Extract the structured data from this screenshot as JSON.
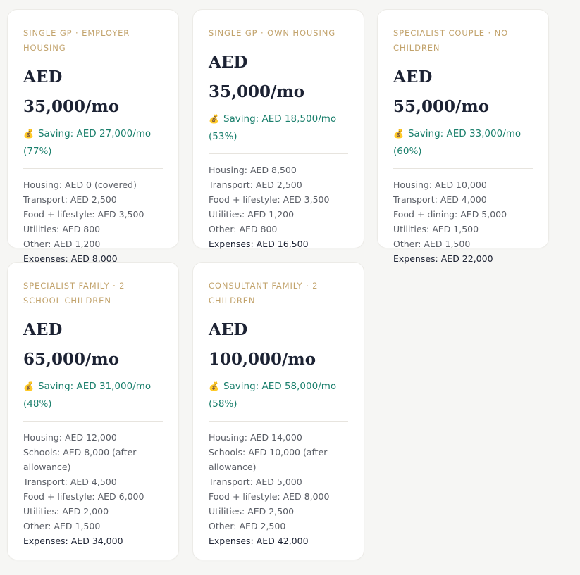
{
  "cards": [
    {
      "label": "SINGLE GP · EMPLOYER HOUSING",
      "salary": "AED 35,000/mo",
      "saving_icon": "money-bag-icon",
      "saving": "Saving: AED 27,000/mo (77%)",
      "expenses": [
        "Housing: AED 0 (covered)",
        "Transport: AED 2,500",
        "Food + lifestyle: AED 3,500",
        "Utilities: AED 800",
        "Other: AED 1,200"
      ],
      "total": "Expenses: AED 8,000"
    },
    {
      "label": "SINGLE GP · OWN HOUSING",
      "salary": "AED 35,000/mo",
      "saving_icon": "money-bag-icon",
      "saving": "Saving: AED 18,500/mo (53%)",
      "expenses": [
        "Housing: AED 8,500",
        "Transport: AED 2,500",
        "Food + lifestyle: AED 3,500",
        "Utilities: AED 1,200",
        "Other: AED 800"
      ],
      "total": "Expenses: AED 16,500"
    },
    {
      "label": "SPECIALIST COUPLE · NO CHILDREN",
      "salary": "AED 55,000/mo",
      "saving_icon": "money-bag-icon",
      "saving": "Saving: AED 33,000/mo (60%)",
      "expenses": [
        "Housing: AED 10,000",
        "Transport: AED 4,000",
        "Food + dining: AED 5,000",
        "Utilities: AED 1,500",
        "Other: AED 1,500"
      ],
      "total": "Expenses: AED 22,000"
    },
    {
      "label": "SPECIALIST FAMILY · 2 SCHOOL CHILDREN",
      "salary": "AED 65,000/mo",
      "saving_icon": "money-bag-icon",
      "saving": "Saving: AED 31,000/mo (48%)",
      "expenses": [
        "Housing: AED 12,000",
        "Schools: AED 8,000 (after allowance)",
        "Transport: AED 4,500",
        "Food + lifestyle: AED 6,000",
        "Utilities: AED 2,000",
        "Other: AED 1,500"
      ],
      "total": "Expenses: AED 34,000"
    },
    {
      "label": "CONSULTANT FAMILY · 2 CHILDREN",
      "salary": "AED 100,000/mo",
      "saving_icon": "money-bag-icon",
      "saving": "Saving: AED 58,000/mo (58%)",
      "expenses": [
        "Housing: AED 14,000",
        "Schools: AED 10,000 (after allowance)",
        "Transport: AED 5,000",
        "Food + lifestyle: AED 8,000",
        "Utilities: AED 2,500",
        "Other: AED 2,500"
      ],
      "total": "Expenses: AED 42,000"
    }
  ]
}
